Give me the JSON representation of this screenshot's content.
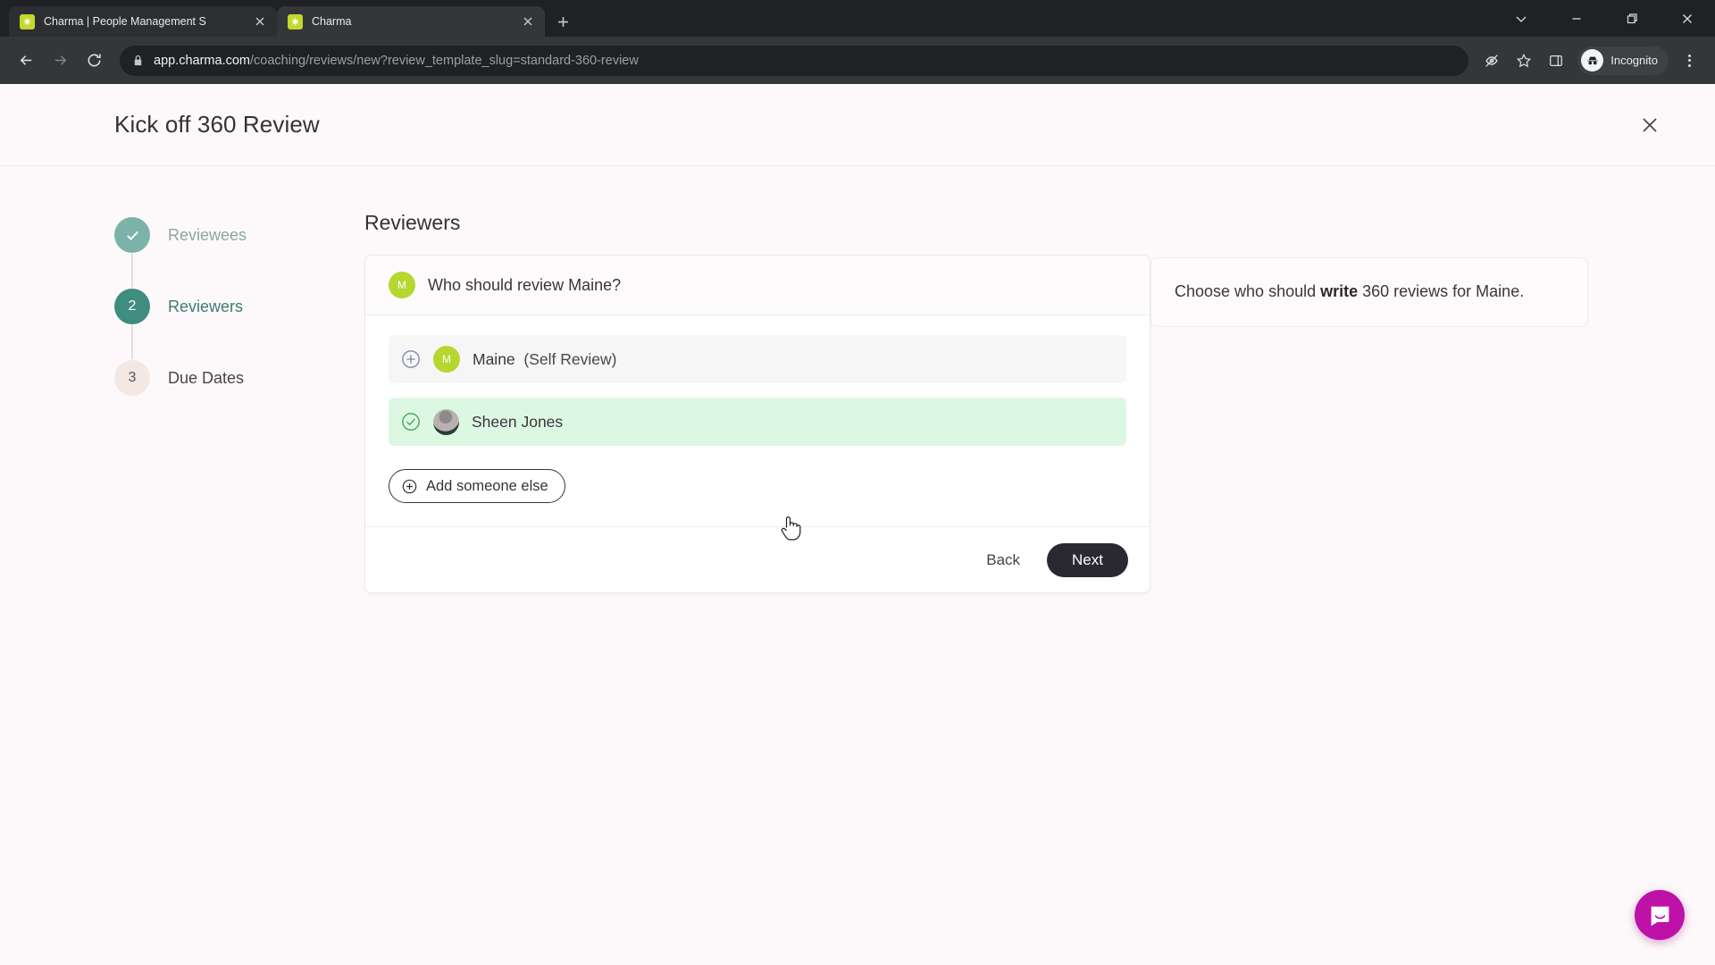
{
  "browser": {
    "tabs": [
      {
        "title": "Charma | People Management S",
        "favicon": "charma-favicon",
        "active": false
      },
      {
        "title": "Charma",
        "favicon": "charma-favicon",
        "active": true
      }
    ],
    "new_tab_label": "+",
    "window_controls": [
      "tab-search-chevron-down",
      "minimize",
      "maximize",
      "close"
    ],
    "omnibox": {
      "domain": "app.charma.com",
      "path": "/coaching/reviews/new?review_template_slug=standard-360-review",
      "lock": "secure-lock-icon"
    },
    "toolbar_icons": [
      "back-arrow",
      "forward-arrow",
      "reload",
      "eye-off",
      "bookmark-star",
      "side-panel",
      "kebab-menu"
    ],
    "profile": {
      "label": "Incognito",
      "icon": "incognito-hat-icon"
    }
  },
  "modal": {
    "title": "Kick off 360 Review",
    "close_label": "×"
  },
  "stepper": {
    "steps": [
      {
        "number": "1",
        "label": "Reviewees",
        "state": "done"
      },
      {
        "number": "2",
        "label": "Reviewers",
        "state": "current"
      },
      {
        "number": "3",
        "label": "Due Dates",
        "state": "upcoming"
      }
    ]
  },
  "main": {
    "section_title": "Reviewers",
    "card_question": "Who should review Maine?",
    "card_question_avatar": "M",
    "reviewers": [
      {
        "name": "Maine",
        "suffix": "(Self Review)",
        "avatar_type": "initial",
        "avatar_initial": "M",
        "selected": false,
        "icon": "plus-circle-icon"
      },
      {
        "name": "Sheen Jones",
        "suffix": "",
        "avatar_type": "photo",
        "avatar_initial": "",
        "selected": true,
        "icon": "check-circle-icon"
      }
    ],
    "add_button_label": "Add someone else",
    "back_label": "Back",
    "next_label": "Next"
  },
  "help": {
    "text_before": "Choose who should ",
    "text_bold": "write",
    "text_after": " 360 reviews for Maine."
  },
  "widgets": {
    "intercom_label": "intercom-messenger-icon"
  },
  "colors": {
    "accent_green": "#b5d730",
    "step_current": "#3f8c80",
    "step_done": "#7cb3a9",
    "selected_row": "#ddf8e2",
    "next_button": "#2b2930",
    "intercom": "#bd11a8"
  }
}
